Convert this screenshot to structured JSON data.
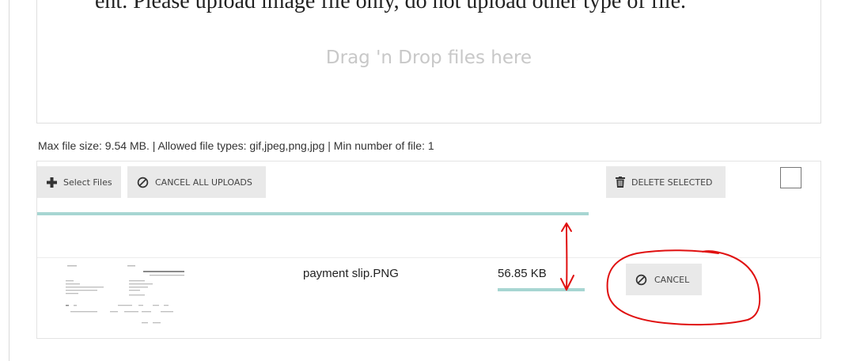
{
  "header_text": "ent. Please upload image file only, do not upload other type of file.",
  "dropzone": {
    "text": "Drag 'n Drop files here"
  },
  "info_text": "Max file size: 9.54 MB. | Allowed file types: gif,jpeg,png,jpg | Min number of file: 1",
  "toolbar": {
    "select_files_label": "Select Files",
    "cancel_all_label": "CANCEL ALL UPLOADS",
    "delete_selected_label": "DELETE SELECTED",
    "select_all_checked": false
  },
  "overall_progress": 1.0,
  "files": [
    {
      "name": "payment slip.PNG",
      "size": "56.85 KB",
      "progress": 1.0,
      "cancel_label": "CANCEL"
    }
  ],
  "icons": {
    "select": "plus-icon",
    "cancel_all": "ban-icon",
    "delete": "trash-icon",
    "cancel_row": "ban-icon"
  },
  "colors": {
    "progress": "#a7d6d2",
    "button_bg": "#e9e9e9",
    "annotation": "#e01010"
  }
}
